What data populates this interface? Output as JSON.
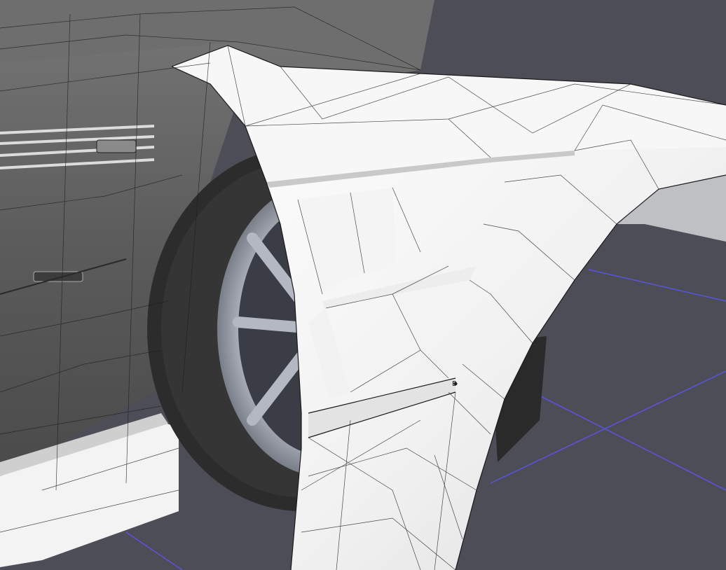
{
  "viewport": {
    "background_color": "#4d4d57",
    "grid_color": "#5a55e0",
    "body_color": "#5e5e5e",
    "flare_color": "#f4f4f4",
    "wire_color": "#1e1e1e",
    "tire_color": "#2c2c2c",
    "rim_color": "#b8bcc6",
    "vertex_label": "B"
  }
}
